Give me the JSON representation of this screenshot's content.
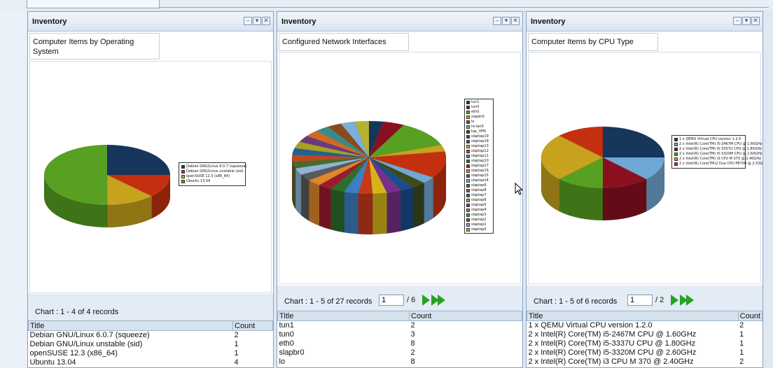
{
  "panels": [
    {
      "title": "Inventory",
      "chart_title": "Computer Items by Operating System",
      "records_text": "Chart : 1 - 4 of 4 records",
      "columns": [
        "Title",
        "Count"
      ],
      "rows": [
        [
          "Debian GNU/Linux 6.0.7 (squeeze)",
          "2"
        ],
        [
          "Debian GNU/Linux unstable (sid)",
          "1"
        ],
        [
          "openSUSE 12.3 (x86_64)",
          "1"
        ],
        [
          "Ubuntu 13.04",
          "4"
        ]
      ],
      "legend": [
        "Debian GNU/Linux 6.0.7 (squeeze)",
        "Debian GNU/Linux unstable (sid)",
        "openSUSE 12.3 (x86_64)",
        "Ubuntu 13.04"
      ]
    },
    {
      "title": "Inventory",
      "chart_title": "Configured Network Interfaces",
      "records_text": "Chart : 1 - 5 of 27 records",
      "page_value": "1",
      "page_total": "/ 6",
      "columns": [
        "Title",
        "Count"
      ],
      "rows": [
        [
          "tun1",
          "2"
        ],
        [
          "tun0",
          "3"
        ],
        [
          "eth0",
          "8"
        ],
        [
          "slapbr0",
          "2"
        ],
        [
          "lo",
          "8"
        ]
      ],
      "legend": [
        "tun1",
        "tun0",
        "eth0",
        "slapbr0",
        "lo",
        "re-lan0",
        "tap_VPN",
        "slaptap19",
        "slaptap18",
        "slaptap13",
        "slaptap12",
        "slaptap11",
        "slaptap10",
        "slaptap17",
        "slaptap16",
        "slaptap15",
        "slaptap14",
        "slaptap9",
        "slaptap8",
        "slaptap7",
        "slaptap6",
        "slaptap5",
        "slaptap4",
        "slaptap3",
        "slaptap2",
        "slaptap1",
        "slaptap0"
      ]
    },
    {
      "title": "Inventory",
      "chart_title": "Computer Items by CPU Type",
      "records_text": "Chart : 1 - 5 of 6 records",
      "page_value": "1",
      "page_total": "/ 2",
      "columns": [
        "Title",
        "Count"
      ],
      "rows": [
        [
          "1 x QEMU Virtual CPU version 1.2.0",
          "2"
        ],
        [
          "2 x Intel(R) Core(TM) i5-2467M CPU @ 1.60GHz",
          "1"
        ],
        [
          "2 x Intel(R) Core(TM) i5-3337U CPU @ 1.80GHz",
          "1"
        ],
        [
          "2 x Intel(R) Core(TM) i5-3320M CPU @ 2.60GHz",
          "1"
        ],
        [
          "2 x Intel(R) Core(TM) i3 CPU M 370 @ 2.40GHz",
          "2"
        ]
      ],
      "legend": [
        "1 x QEMU Virtual CPU version 1.2.0",
        "2 x Intel(R) Core(TM) i5-2467M CPU @ 1.60GHz",
        "2 x Intel(R) Core(TM) i5-3337U CPU @ 1.80GHz",
        "2 x Intel(R) Core(TM) i5-3320M CPU @ 2.60GHz",
        "2 x Intel(R) Core(TM) i3 CPU M 370 @ 2.40GHz",
        "2 x Intel(R) Core(TM)2 Duo CPU P8700 @ 2.53GHz"
      ]
    }
  ],
  "chart_data": [
    {
      "type": "pie",
      "categories": [
        "Debian GNU/Linux 6.0.7 (squeeze)",
        "Debian GNU/Linux unstable (sid)",
        "openSUSE 12.3 (x86_64)",
        "Ubuntu 13.04"
      ],
      "values": [
        2,
        1,
        1,
        4
      ],
      "colors": [
        "#16365c",
        "#c4300f",
        "#c7a21c",
        "#58a022"
      ]
    },
    {
      "type": "pie",
      "categories": [
        "tun1",
        "tun0",
        "eth0",
        "slapbr0",
        "lo",
        "re-lan0",
        "tap_VPN",
        "slaptap19",
        "slaptap18",
        "slaptap13",
        "slaptap12",
        "slaptap11",
        "slaptap10",
        "slaptap17",
        "slaptap16",
        "slaptap15",
        "slaptap14",
        "slaptap9",
        "slaptap8",
        "slaptap7",
        "slaptap6",
        "slaptap5",
        "slaptap4",
        "slaptap3",
        "slaptap2",
        "slaptap1",
        "slaptap0"
      ],
      "values": [
        2,
        3,
        8,
        2,
        8,
        2,
        2,
        2,
        2,
        2,
        2,
        2,
        2,
        2,
        2,
        2,
        2,
        2,
        2,
        2,
        2,
        2,
        2,
        2,
        2,
        2,
        2
      ],
      "colors": [
        "#16365c",
        "#8a1020",
        "#58a022",
        "#c7a21c",
        "#c4300f",
        "#6fa8d6",
        "#3d4a1e",
        "#1b4c8c",
        "#7a2e8a",
        "#d4b418",
        "#c8391a",
        "#3c7fc0",
        "#2c6e2c",
        "#9a1c2c",
        "#e0872a",
        "#5a5a5a",
        "#8fb4d8",
        "#4a6a2c",
        "#b84a20",
        "#246090",
        "#a8a020",
        "#6a3a7a",
        "#d06a20",
        "#3a8a8a",
        "#8a4a1a",
        "#7ab0d8",
        "#b8b030"
      ]
    },
    {
      "type": "pie",
      "categories": [
        "1 x QEMU Virtual CPU version 1.2.0",
        "2 x Intel(R) Core(TM) i5-2467M CPU @ 1.60GHz",
        "2 x Intel(R) Core(TM) i5-3337U CPU @ 1.80GHz",
        "2 x Intel(R) Core(TM) i5-3320M CPU @ 2.60GHz",
        "2 x Intel(R) Core(TM) i3 CPU M 370 @ 2.40GHz",
        "2 x Intel(R) Core(TM)2 Duo CPU P8700 @ 2.53GHz"
      ],
      "values": [
        2,
        1,
        1,
        1,
        2,
        1
      ],
      "colors": [
        "#16365c",
        "#6fa8d6",
        "#8a1020",
        "#58a022",
        "#c7a21c",
        "#c4300f"
      ]
    }
  ]
}
